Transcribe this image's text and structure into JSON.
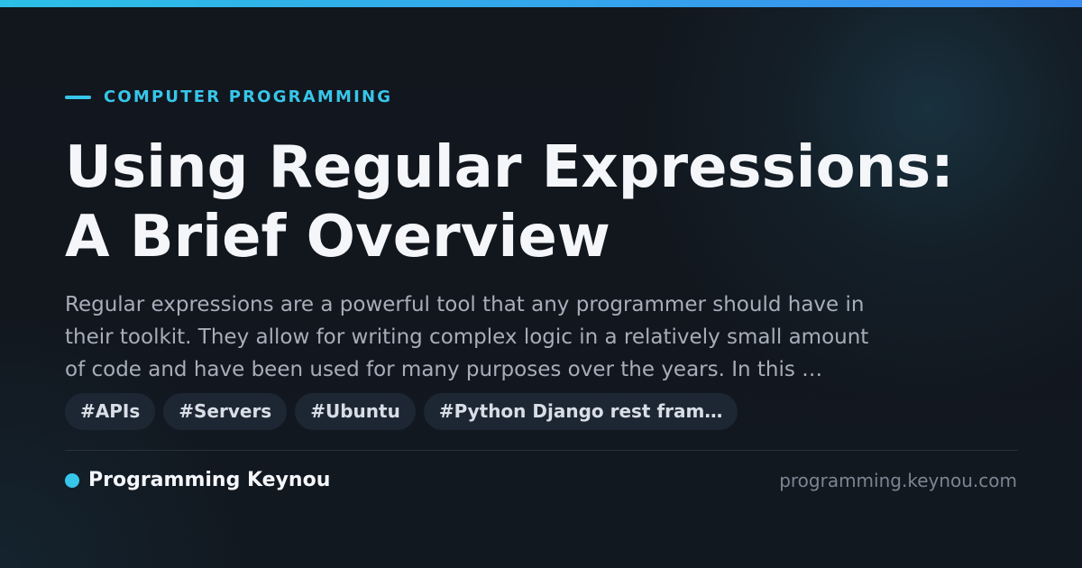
{
  "category": {
    "label": "COMPUTER PROGRAMMING",
    "accent_color": "#37c6ea"
  },
  "article": {
    "title_lines": [
      "Using Regular Expressions:",
      "A Brief Overview"
    ],
    "summary_lines": [
      "Regular expressions are a powerful tool that any programmer should have in",
      "their toolkit. They allow for writing complex logic in a relatively small amount",
      "of code and have been used for many purposes over the years. In this …"
    ]
  },
  "tags": [
    "#APIs",
    "#Servers",
    "#Ubuntu",
    "#Python Django rest fram…"
  ],
  "footer": {
    "site_name": "Programming Keynou",
    "domain": "programming.keynou.com",
    "dot_color": "#37c6ea"
  }
}
